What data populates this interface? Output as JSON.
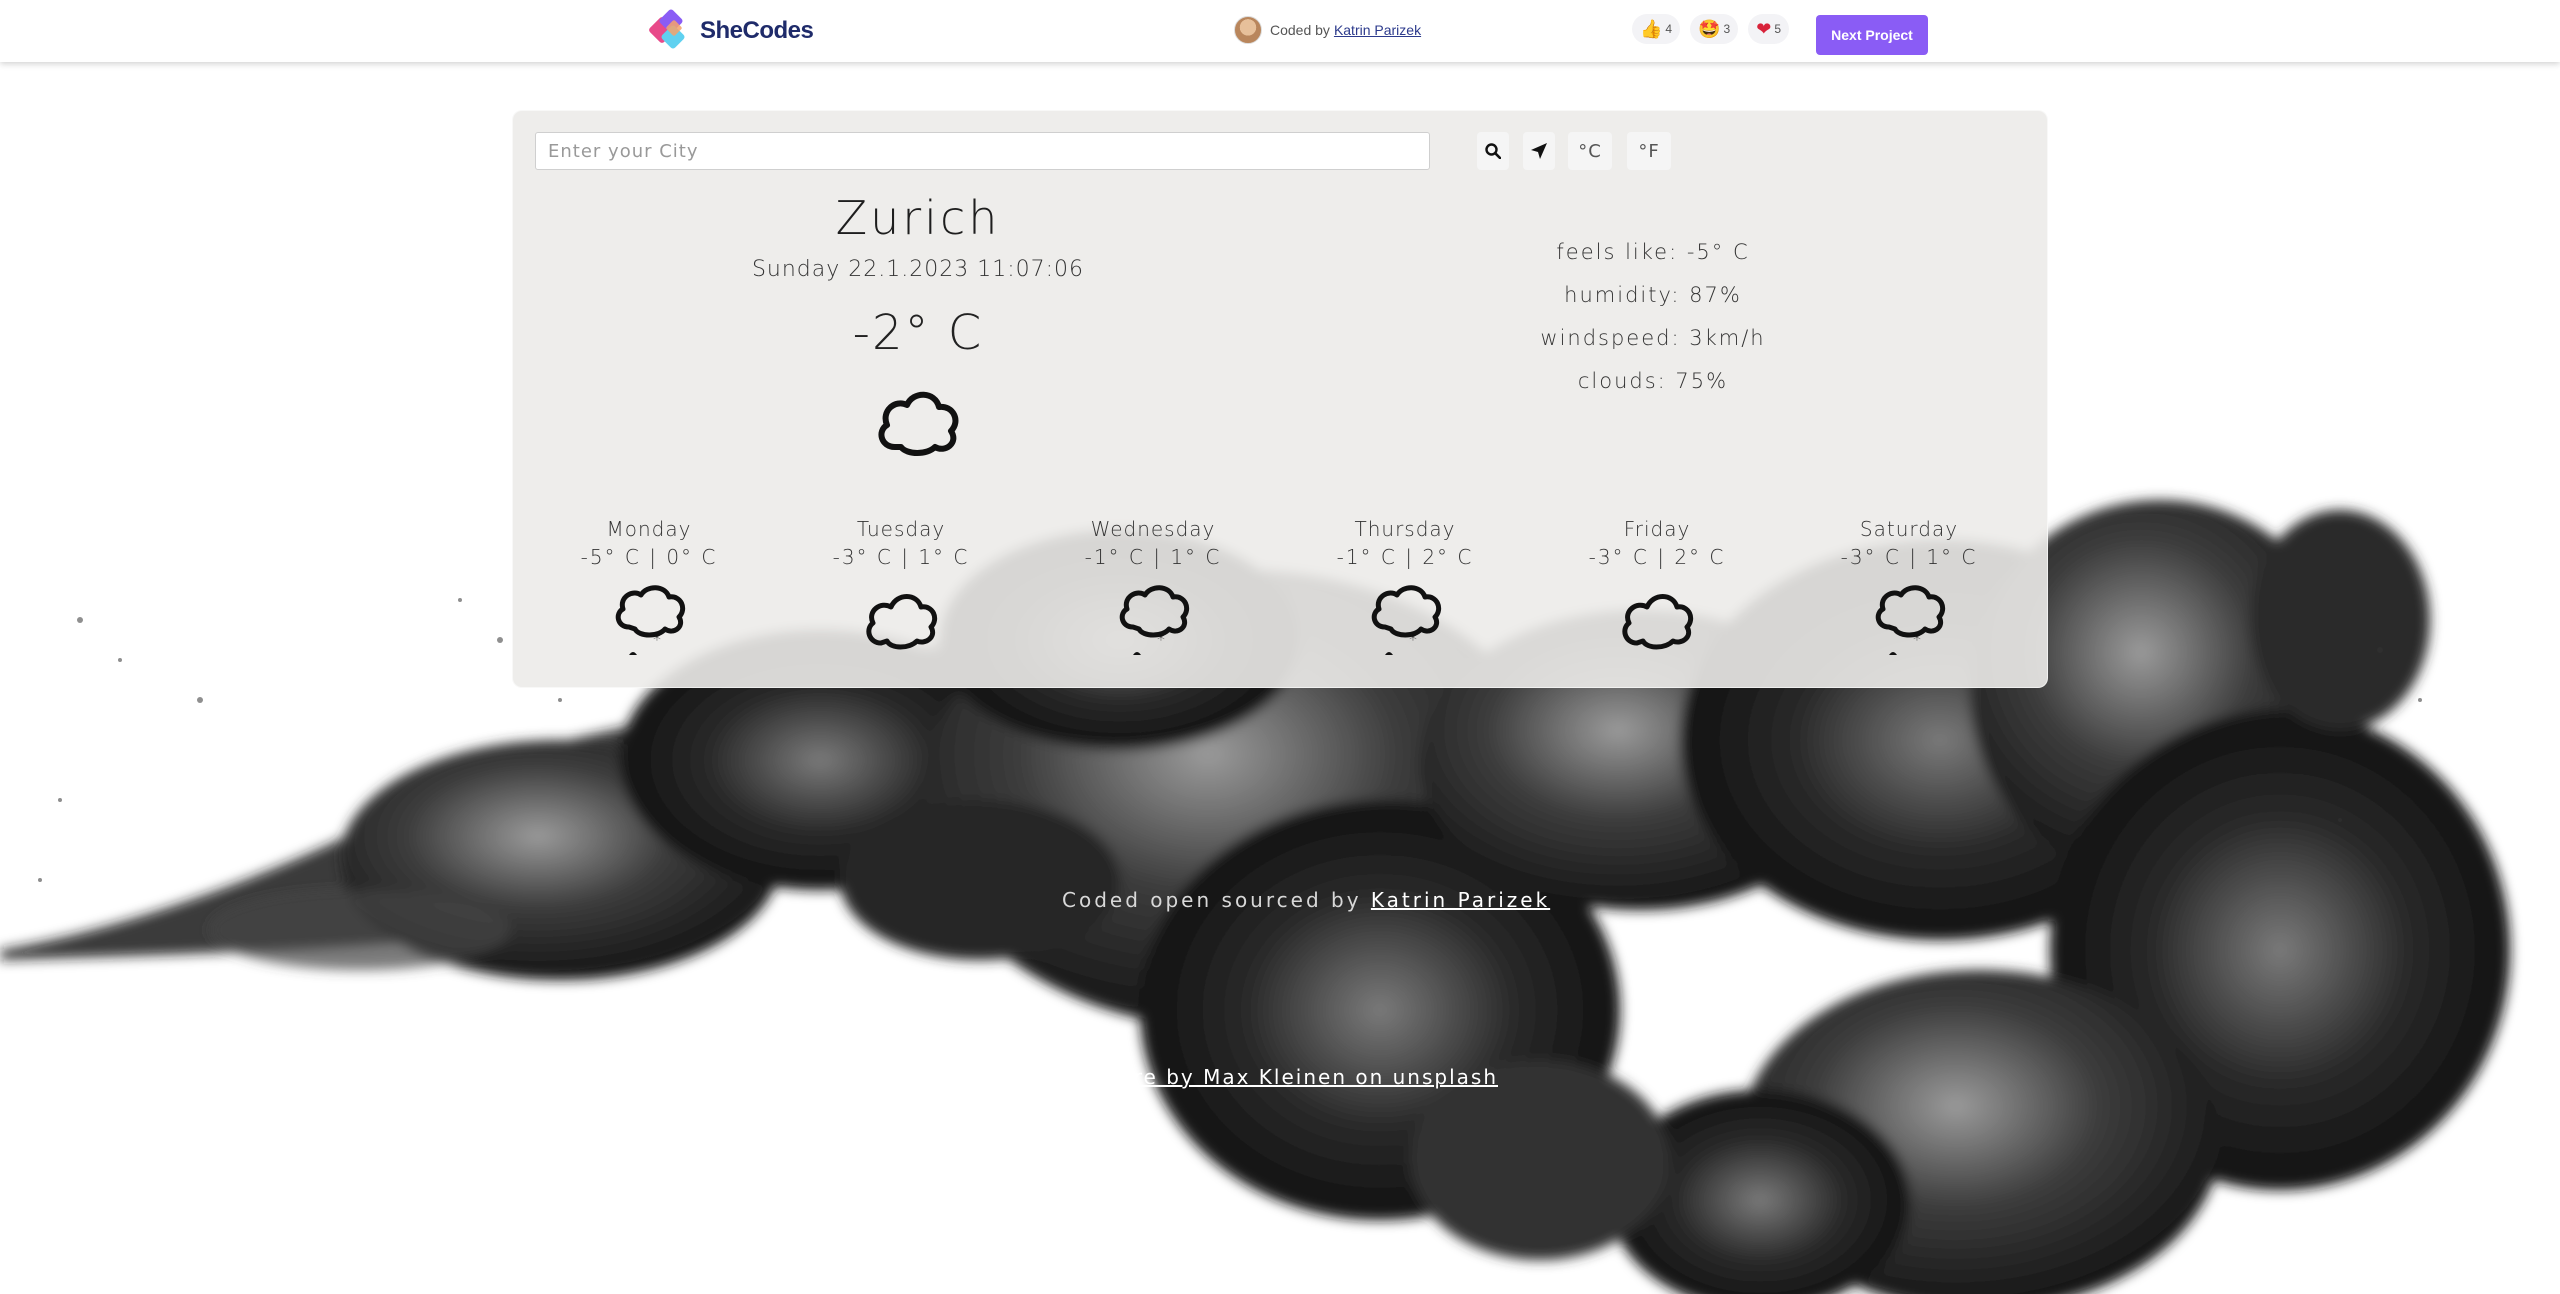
{
  "topbar": {
    "brand": "SheCodes",
    "coded_by_prefix": "Coded by",
    "coded_by_name": "Katrin Parizek",
    "reactions": [
      {
        "icon": "thumbs-up-icon",
        "glyph": "👍",
        "count": "4"
      },
      {
        "icon": "star-struck-icon",
        "glyph": "🤩",
        "count": "3"
      },
      {
        "icon": "heart-icon",
        "glyph": "❤",
        "count": "5"
      }
    ],
    "next_button": "Next Project"
  },
  "search": {
    "placeholder": "Enter your City",
    "value": "",
    "celsius_label": "°C",
    "fahrenheit_label": "°F"
  },
  "current": {
    "city": "Zurich",
    "datetime": "Sunday 22.1.2023 11:07:06",
    "temperature": "-2° C",
    "icon": "cloud-icon",
    "feels_like": "feels like: -5° C",
    "humidity": "humidity: 87%",
    "windspeed": "windspeed: 3km/h",
    "clouds": "clouds: 75%"
  },
  "forecast": [
    {
      "day": "Monday",
      "temps": "-5° C | 0° C",
      "icon": "snow-cloud-icon"
    },
    {
      "day": "Tuesday",
      "temps": "-3° C | 1° C",
      "icon": "cloud-icon"
    },
    {
      "day": "Wednesday",
      "temps": "-1° C | 1° C",
      "icon": "snow-cloud-icon"
    },
    {
      "day": "Thursday",
      "temps": "-1° C | 2° C",
      "icon": "snow-cloud-icon"
    },
    {
      "day": "Friday",
      "temps": "-3° C | 2° C",
      "icon": "cloud-icon"
    },
    {
      "day": "Saturday",
      "temps": "-3° C | 1° C",
      "icon": "snow-cloud-icon"
    }
  ],
  "footer": {
    "credit_prefix": "Coded open sourced by",
    "credit_name": "Katrin Parizek",
    "picture_credit": "picture by Max Kleinen on unsplash"
  },
  "colors": {
    "accent": "#8a5cf5",
    "card": "#ecebe9",
    "brand_text": "#1f2b6a"
  }
}
